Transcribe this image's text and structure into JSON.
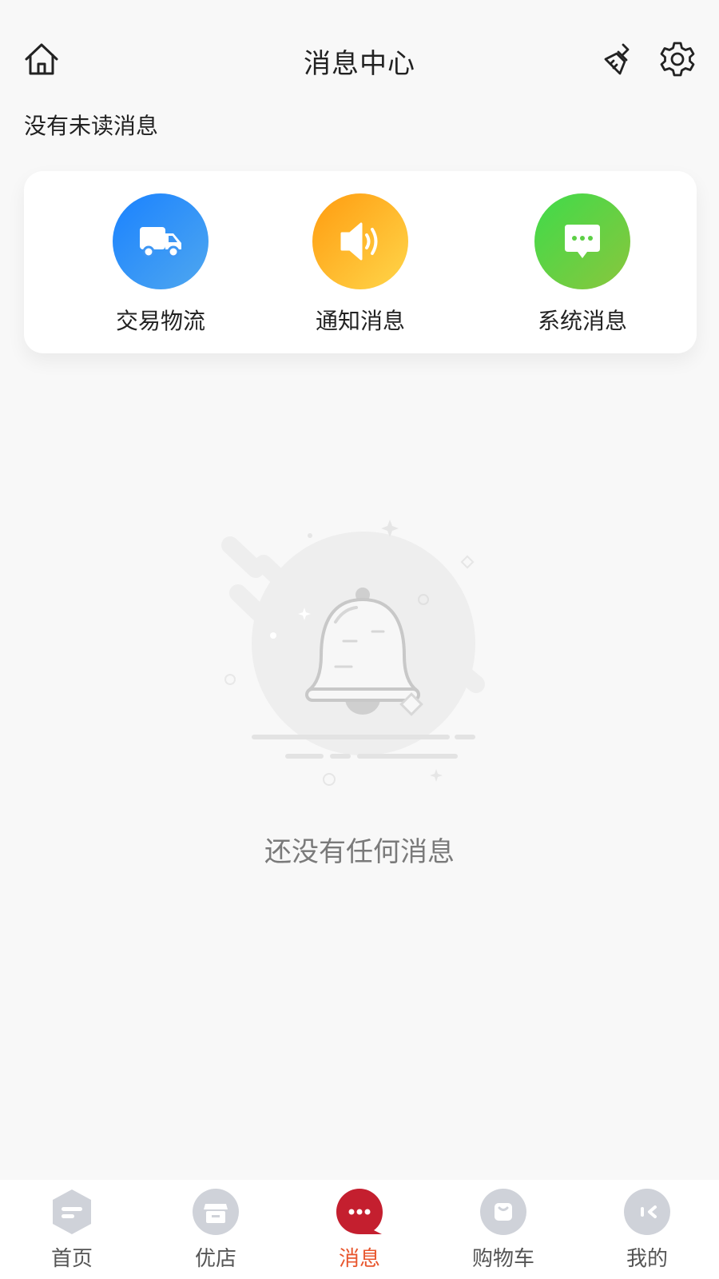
{
  "header": {
    "title": "消息中心",
    "home_icon": "home-icon",
    "clear_icon": "broom-icon",
    "settings_icon": "gear-icon"
  },
  "unread_status": "没有未读消息",
  "categories": [
    {
      "label": "交易物流",
      "icon": "truck-icon",
      "color": "#1a82ff"
    },
    {
      "label": "通知消息",
      "icon": "speaker-icon",
      "color": "#ffab1a"
    },
    {
      "label": "系统消息",
      "icon": "chat-bubble-icon",
      "color": "#4ed64a"
    }
  ],
  "empty_state": {
    "icon": "bell-icon",
    "text": "还没有任何消息"
  },
  "bottom_nav": {
    "active_color": "#e8562d",
    "items": [
      {
        "label": "首页",
        "icon": "home-tab-icon",
        "active": false
      },
      {
        "label": "优店",
        "icon": "shop-icon",
        "active": false
      },
      {
        "label": "消息",
        "icon": "message-icon",
        "active": true
      },
      {
        "label": "购物车",
        "icon": "cart-icon",
        "active": false
      },
      {
        "label": "我的",
        "icon": "profile-icon",
        "active": false
      }
    ]
  }
}
